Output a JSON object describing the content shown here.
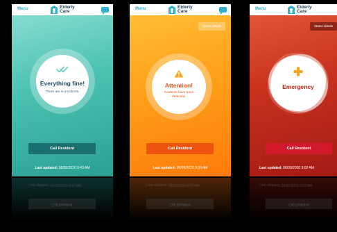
{
  "app": {
    "menu_label": "Menu",
    "brand_line1": "Elderly",
    "brand_line2": "Care",
    "brand_color": "#1c3c5a",
    "accent_color": "#34b1c9"
  },
  "screens": [
    {
      "state": "fine",
      "title": "Everything fine!",
      "subtitle": "There are no incidents.",
      "icon": "double-check-icon",
      "call_label": "Call Resident",
      "updated_label": "Last updated:",
      "updated_value": "06/09/2020 8:43 AM",
      "accent": "#1b6f6e"
    },
    {
      "state": "attention",
      "title": "Attention!",
      "subtitle": "Incidents have been detected.",
      "icon": "warning-icon",
      "status_label": "Status details",
      "call_label": "Call Resident",
      "updated_label": "Last updated:",
      "updated_value": "06/09/2020 9:00 AM",
      "accent": "#ef5310"
    },
    {
      "state": "emergency",
      "title": "Emergency",
      "icon": "medical-cross-icon",
      "status_label": "Status details",
      "call_label": "Call Resident",
      "updated_label": "Last updated:",
      "updated_value": "06/09/2020 9:02 AM",
      "accent": "#d21a2c"
    }
  ]
}
